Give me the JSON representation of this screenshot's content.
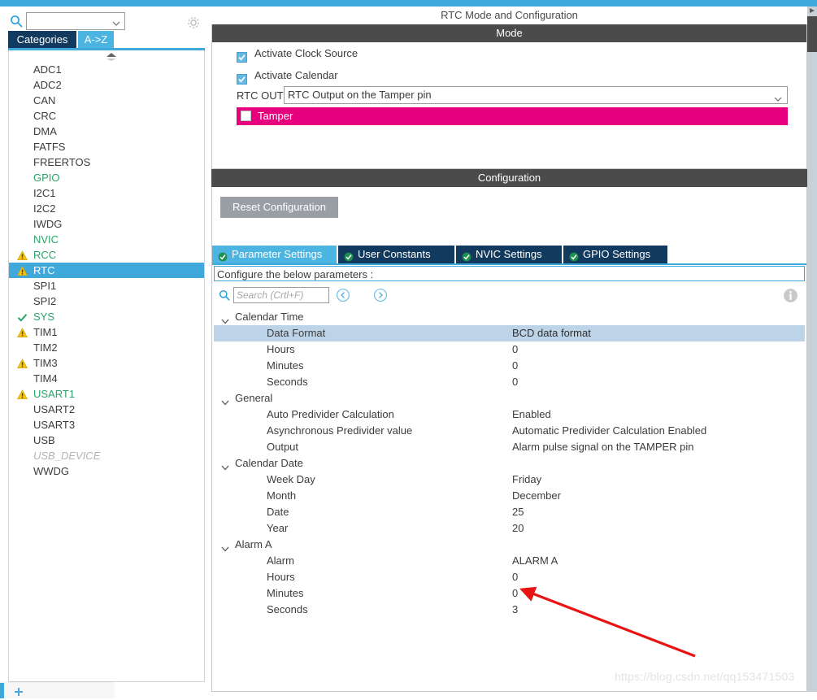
{
  "window": {
    "accent_color": "#3fa9dc",
    "title": "RTC Mode and Configuration"
  },
  "sidebar": {
    "search": {
      "placeholder": "",
      "value": "",
      "icon": "search-icon"
    },
    "gear_icon": "gear-icon",
    "tabs": [
      {
        "label": "Categories",
        "active": true
      },
      {
        "label": "A->Z",
        "active": false
      }
    ],
    "items": [
      {
        "label": "ADC1",
        "state": "normal",
        "icon": "none"
      },
      {
        "label": "ADC2",
        "state": "normal",
        "icon": "none"
      },
      {
        "label": "CAN",
        "state": "normal",
        "icon": "none"
      },
      {
        "label": "CRC",
        "state": "normal",
        "icon": "none"
      },
      {
        "label": "DMA",
        "state": "normal",
        "icon": "none"
      },
      {
        "label": "FATFS",
        "state": "normal",
        "icon": "none"
      },
      {
        "label": "FREERTOS",
        "state": "normal",
        "icon": "none"
      },
      {
        "label": "GPIO",
        "state": "green",
        "icon": "none"
      },
      {
        "label": "I2C1",
        "state": "normal",
        "icon": "none"
      },
      {
        "label": "I2C2",
        "state": "normal",
        "icon": "none"
      },
      {
        "label": "IWDG",
        "state": "normal",
        "icon": "none"
      },
      {
        "label": "NVIC",
        "state": "green",
        "icon": "none"
      },
      {
        "label": "RCC",
        "state": "green",
        "icon": "warning-triangle-icon"
      },
      {
        "label": "RTC",
        "state": "selected",
        "icon": "warning-triangle-icon"
      },
      {
        "label": "SPI1",
        "state": "normal",
        "icon": "none"
      },
      {
        "label": "SPI2",
        "state": "normal",
        "icon": "none"
      },
      {
        "label": "SYS",
        "state": "green",
        "icon": "check-icon"
      },
      {
        "label": "TIM1",
        "state": "normal",
        "icon": "warning-triangle-icon"
      },
      {
        "label": "TIM2",
        "state": "normal",
        "icon": "none"
      },
      {
        "label": "TIM3",
        "state": "normal",
        "icon": "warning-triangle-icon"
      },
      {
        "label": "TIM4",
        "state": "normal",
        "icon": "none"
      },
      {
        "label": "USART1",
        "state": "green",
        "icon": "warning-triangle-icon"
      },
      {
        "label": "USART2",
        "state": "normal",
        "icon": "none"
      },
      {
        "label": "USART3",
        "state": "normal",
        "icon": "none"
      },
      {
        "label": "USB",
        "state": "normal",
        "icon": "none"
      },
      {
        "label": "USB_DEVICE",
        "state": "disabled",
        "icon": "none"
      },
      {
        "label": "WWDG",
        "state": "normal",
        "icon": "none"
      }
    ]
  },
  "mode": {
    "header": "Mode",
    "checkboxes": [
      {
        "label": "Activate Clock Source",
        "checked": true
      },
      {
        "label": "Activate Calendar",
        "checked": true
      }
    ],
    "rtc_out": {
      "label": "RTC OUT",
      "value": "RTC Output on the Tamper pin"
    },
    "tamper": {
      "label": "Tamper",
      "checked": false,
      "color": "#e6007e"
    }
  },
  "configuration": {
    "header": "Configuration",
    "reset_button": "Reset Configuration",
    "tabs": [
      {
        "label": "Parameter Settings",
        "active": true
      },
      {
        "label": "User Constants",
        "active": false
      },
      {
        "label": "NVIC Settings",
        "active": false
      },
      {
        "label": "GPIO Settings",
        "active": false
      }
    ],
    "hint": "Configure the below parameters :",
    "search_placeholder": "Search (Crtl+F)",
    "search_value": "",
    "groups": [
      {
        "name": "Calendar Time",
        "expanded": true,
        "rows": [
          {
            "name": "Data Format",
            "value": "BCD data format",
            "highlight": true
          },
          {
            "name": "Hours",
            "value": "0",
            "highlight": false
          },
          {
            "name": "Minutes",
            "value": "0",
            "highlight": false
          },
          {
            "name": "Seconds",
            "value": "0",
            "highlight": false
          }
        ]
      },
      {
        "name": "General",
        "expanded": true,
        "rows": [
          {
            "name": "Auto Predivider Calculation",
            "value": "Enabled",
            "highlight": false
          },
          {
            "name": "Asynchronous Predivider value",
            "value": "Automatic Predivider Calculation Enabled",
            "highlight": false
          },
          {
            "name": "Output",
            "value": "Alarm pulse signal on the TAMPER pin",
            "highlight": false
          }
        ]
      },
      {
        "name": "Calendar Date",
        "expanded": true,
        "rows": [
          {
            "name": "Week Day",
            "value": "Friday",
            "highlight": false
          },
          {
            "name": "Month",
            "value": "December",
            "highlight": false
          },
          {
            "name": "Date",
            "value": "25",
            "highlight": false
          },
          {
            "name": "Year",
            "value": "20",
            "highlight": false
          }
        ]
      },
      {
        "name": "Alarm A",
        "expanded": true,
        "rows": [
          {
            "name": "Alarm",
            "value": "ALARM A",
            "highlight": false
          },
          {
            "name": "Hours",
            "value": "0",
            "highlight": false
          },
          {
            "name": "Minutes",
            "value": "0",
            "highlight": false
          },
          {
            "name": "Seconds",
            "value": "3",
            "highlight": false
          }
        ]
      }
    ]
  },
  "annotation": {
    "arrow_color": "#e81313",
    "points_at": "Seconds"
  },
  "watermark": "https://blog.csdn.net/qq153471503"
}
